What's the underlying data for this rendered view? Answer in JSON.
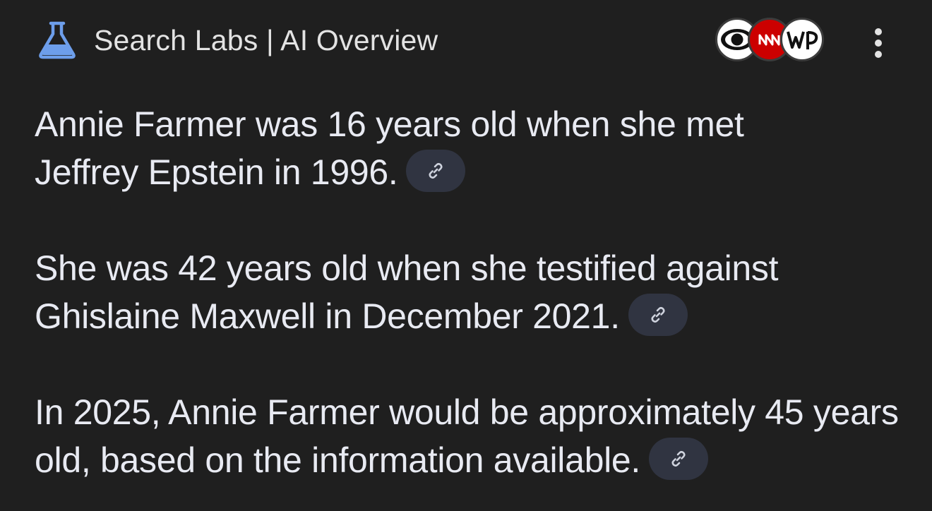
{
  "header": {
    "title": "Search Labs | AI Overview",
    "icon": "flask-icon",
    "accent_color": "#6d9eeb"
  },
  "sources": [
    {
      "name": "CBS",
      "icon": "cbs-eye-logo",
      "text": ""
    },
    {
      "name": "CNN",
      "icon": "cnn-logo",
      "text": ""
    },
    {
      "name": "The Washington Post",
      "icon": "washington-post-logo",
      "text": ""
    }
  ],
  "menu": {
    "icon": "more-vert-icon"
  },
  "paragraphs": [
    {
      "text": "Annie Farmer was 16 years old when she met Jeffrey Epstein in 1996.",
      "link_icon": "link-icon"
    },
    {
      "text": "She was 42 years old when she testified against Ghislaine Maxwell in December 2021.",
      "link_icon": "link-icon"
    },
    {
      "text": "In 2025, Annie Farmer would be approximately 45 years old, based on the information available.",
      "link_icon": "link-icon"
    }
  ],
  "colors": {
    "background": "#1f1f1f",
    "text": "#e8eaf2",
    "chip_background": "#303441",
    "cnn_red": "#cc0000"
  }
}
